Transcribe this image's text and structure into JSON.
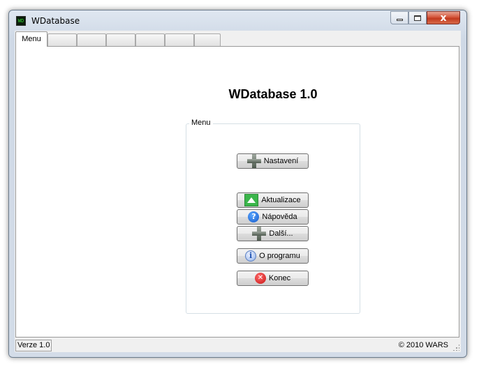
{
  "window": {
    "title": "WDatabase",
    "app_icon_text": "WD",
    "close_glyph": "x"
  },
  "tabs": [
    {
      "label": "Menu",
      "active": true
    },
    {
      "label": "",
      "active": false
    },
    {
      "label": "",
      "active": false
    },
    {
      "label": "",
      "active": false
    },
    {
      "label": "",
      "active": false
    },
    {
      "label": "",
      "active": false
    },
    {
      "label": "",
      "active": false
    }
  ],
  "main": {
    "heading": "WDatabase 1.0",
    "group_label": "Menu",
    "buttons": {
      "settings": {
        "label": "Nastavení",
        "icon": "plus-icon"
      },
      "update": {
        "label": "Aktualizace",
        "icon": "arrow-up-icon"
      },
      "help": {
        "label": "Nápověda",
        "icon": "help-icon",
        "glyph": "?"
      },
      "more": {
        "label": "Další...",
        "icon": "plus-icon"
      },
      "about": {
        "label": "O programu",
        "icon": "info-icon",
        "glyph": "i"
      },
      "exit": {
        "label": "Konec",
        "icon": "close-icon",
        "glyph": "✕"
      }
    }
  },
  "statusbar": {
    "version": "Verze 1.0",
    "copyright": "© 2010 WARS"
  },
  "colors": {
    "close_button": "#c23a1f",
    "update_icon": "#3ab54a",
    "help_icon": "#1559c9",
    "exit_icon": "#c81414"
  }
}
